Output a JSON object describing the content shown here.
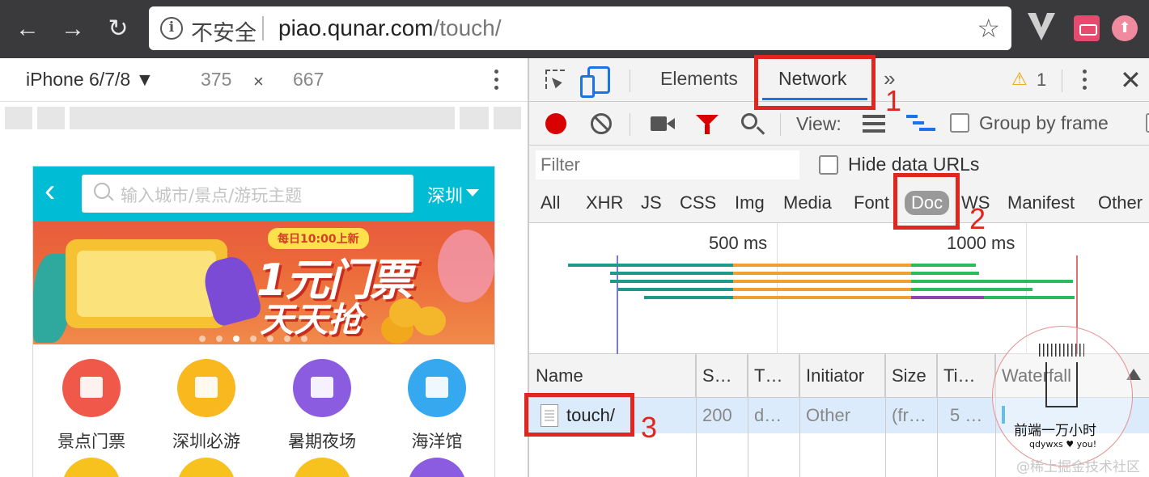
{
  "browser": {
    "security_label": "不安全",
    "url_host": "piao.qunar.com",
    "url_path": "/touch/",
    "back_glyph": "←",
    "forward_glyph": "→",
    "reload_glyph": "↻",
    "star_glyph": "☆"
  },
  "device_toolbar": {
    "device": "iPhone 6/7/8 ▼",
    "width": "375",
    "times": "×",
    "height": "667"
  },
  "phone": {
    "search_placeholder": "输入城市/景点/游玩主题",
    "city": "深圳",
    "banner_badge": "每日10:00上新",
    "banner_line1": "1元门票",
    "banner_line2": "天天抢",
    "categories": [
      {
        "label": "景点门票",
        "color": "#f0594a"
      },
      {
        "label": "深圳必游",
        "color": "#f8b81e"
      },
      {
        "label": "暑期夜场",
        "color": "#8c5ce0"
      },
      {
        "label": "海洋馆",
        "color": "#36a8ef"
      }
    ]
  },
  "devtools": {
    "tabs": [
      "Elements",
      "Network"
    ],
    "more_tabs": "»",
    "warning_icon": "⚠",
    "warning_count": "1",
    "close_glyph": "✕",
    "view_label": "View:",
    "group_by_frame": "Group by frame",
    "filter_placeholder": "Filter",
    "hide_data_urls": "Hide data URLs",
    "resource_types": [
      "All",
      "XHR",
      "JS",
      "CSS",
      "Img",
      "Media",
      "Font",
      "Doc",
      "WS",
      "Manifest",
      "Other"
    ],
    "selected_type": "Doc",
    "timeline_labels": [
      "500 ms",
      "1000 ms"
    ],
    "columns": [
      "Name",
      "S…",
      "T…",
      "Initiator",
      "Size",
      "Ti…",
      "Waterfall"
    ],
    "row": {
      "name": "touch/",
      "status": "200",
      "type": "d…",
      "initiator": "Other",
      "size": "(fr…",
      "time": "5 …"
    }
  },
  "annotations": [
    "1",
    "2",
    "3"
  ],
  "watermark": {
    "title": "前端一万小时",
    "subtitle": "qdywxs ♥ you!",
    "credit": "@稀土掘金技术社区"
  }
}
